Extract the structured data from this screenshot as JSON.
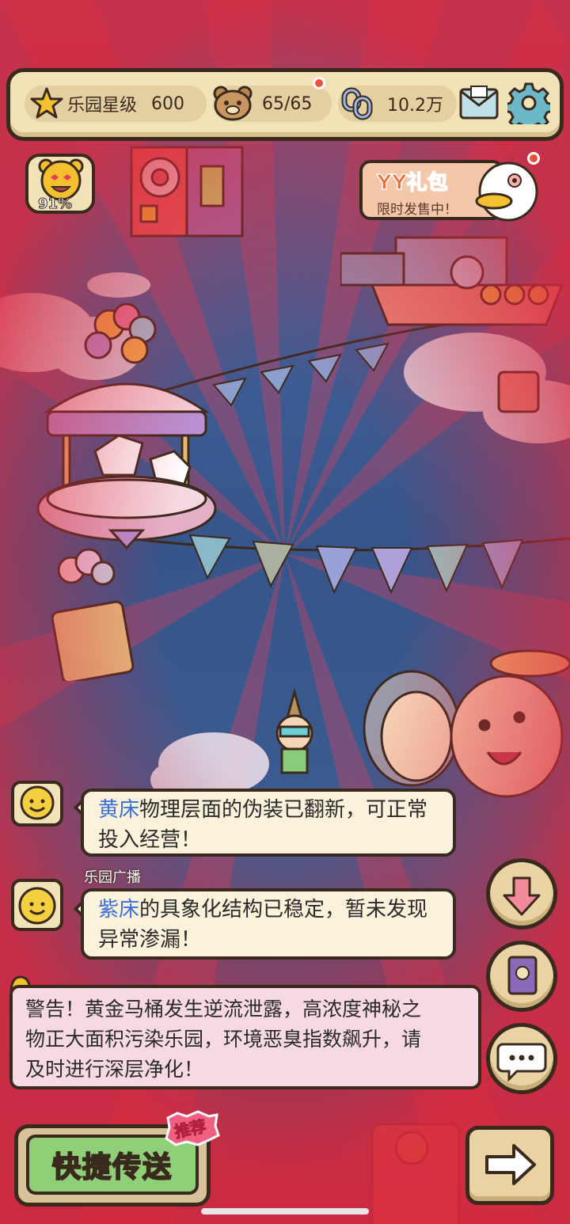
{
  "stats": {
    "park_rating_label": "乐园星级",
    "park_rating_value": "600",
    "bears": "65/65",
    "coins": "10.2万"
  },
  "mood": {
    "percent": "91%"
  },
  "gift": {
    "title": "YY礼包",
    "subtitle": "限时发售中！"
  },
  "chat": {
    "message1": {
      "highlight": "黄床",
      "line1": "物理层面的伪装已翻新，可正常",
      "line2": "投入经营！"
    },
    "sender": "乐园广播",
    "message2": {
      "highlight": "紫床",
      "line1": "的具象化结构已稳定，暂未发现",
      "line2": "异常渗漏！"
    },
    "warning": {
      "line1": "警告！黄金马桶发生逆流泄露，高浓度神秘之",
      "line2": "物正大面积污染乐园，环境恶臭指数飙升，请",
      "line3": "及时进行深层净化！"
    }
  },
  "buttons": {
    "quick_transfer": "快捷传送",
    "recommend": "推荐"
  },
  "colors": {
    "frame": "#3a2a1e",
    "panel": "#f2e2b8",
    "highlight_blue": "#3a6fd8",
    "alert_red": "#f0503c",
    "quick_green": "#8fcf78"
  },
  "icons": {
    "rating": "star-icon",
    "bears": "bear-icon",
    "coins": "link-coin-icon",
    "mail": "mail-icon",
    "settings": "gear-icon",
    "mood": "smiley-bear-icon",
    "scroll_down": "arrow-down-icon",
    "journal": "book-icon",
    "chat": "chat-bubble-icon",
    "next": "arrow-right-icon"
  }
}
